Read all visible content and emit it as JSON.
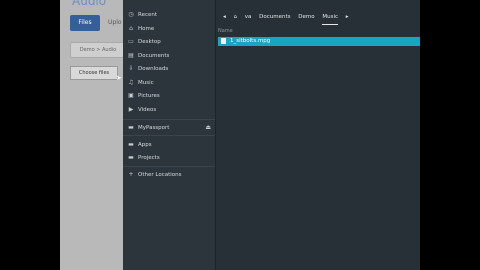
{
  "webpage": {
    "title": "Audio",
    "tab_files": "Files",
    "tab_upload": "Uplo",
    "breadcrumb": "Demo > Audio",
    "choose_files": "Choose files"
  },
  "dialog": {
    "places": [
      {
        "label": "Recent",
        "icon": "clock-icon"
      },
      {
        "label": "Home",
        "icon": "home-icon"
      },
      {
        "label": "Desktop",
        "icon": "desktop-icon"
      },
      {
        "label": "Documents",
        "icon": "documents-icon"
      },
      {
        "label": "Downloads",
        "icon": "downloads-icon"
      },
      {
        "label": "Music",
        "icon": "music-icon"
      },
      {
        "label": "Pictures",
        "icon": "pictures-icon"
      },
      {
        "label": "Videos",
        "icon": "videos-icon"
      }
    ],
    "devices": [
      {
        "label": "MyPassport",
        "icon": "drive-icon"
      }
    ],
    "network": [
      {
        "label": "Apps",
        "icon": "folder-icon"
      },
      {
        "label": "Projects",
        "icon": "folder-icon"
      }
    ],
    "other_locations": "Other Locations",
    "path": [
      "va",
      "Documents",
      "Demo",
      "Music"
    ],
    "column_name": "Name",
    "files": [
      {
        "name": "1_sitbolts.mpg",
        "selected": true
      }
    ]
  },
  "colors": {
    "selection": "#1aa3c4",
    "sidebar_bg": "#2c353b",
    "dialog_bg": "#263036",
    "tab_active": "#355f9a"
  }
}
